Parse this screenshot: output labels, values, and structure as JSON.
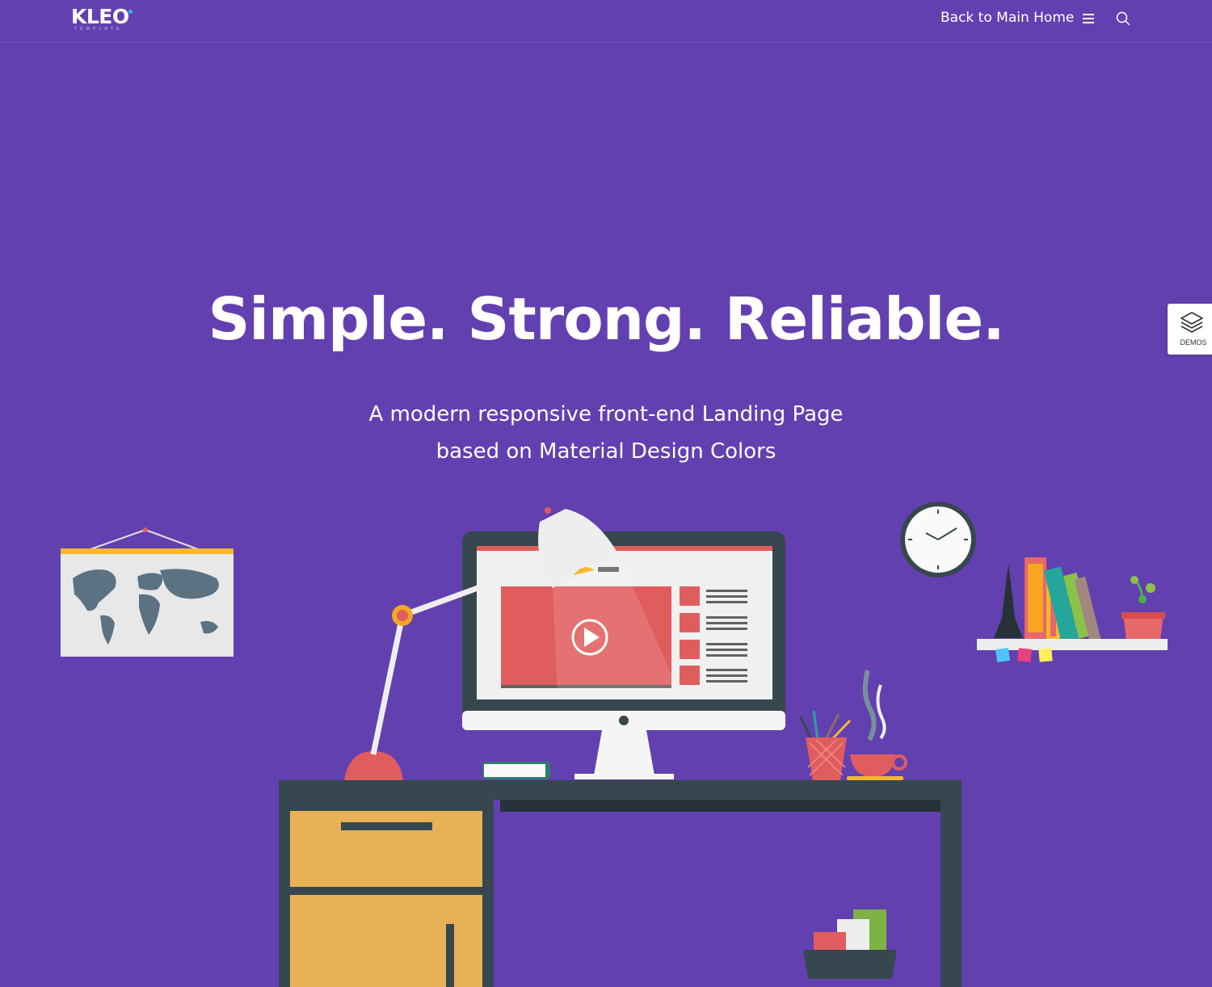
{
  "header": {
    "logo": "KLEO",
    "logo_tagline": "TEMPLATE",
    "nav_link": "Back to Main Home",
    "menu_icon": "hamburger-menu-icon",
    "search_icon": "search-icon"
  },
  "hero": {
    "title": "Simple. Strong. Reliable.",
    "subtitle_line1": "A modern responsive front-end Landing Page",
    "subtitle_line2": "based on Material Design Colors"
  },
  "demos_button": {
    "label": "DEMOS",
    "icon": "layers-icon"
  },
  "colors": {
    "background": "#6340b0",
    "desk": "#37474f",
    "drawer": "#e9b155",
    "screen_red": "#e05d5d",
    "accent_orange": "#f5a623"
  }
}
